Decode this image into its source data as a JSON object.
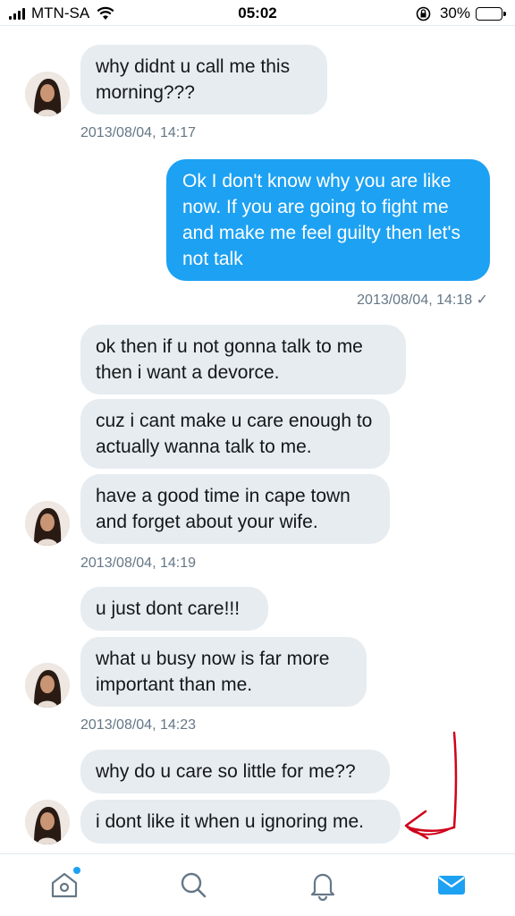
{
  "status_bar": {
    "carrier": "MTN-SA",
    "time": "05:02",
    "battery": "30%",
    "battery_level": 0.3,
    "icons": [
      "signal-icon",
      "wifi-icon",
      "orientation-lock-icon",
      "battery-icon"
    ]
  },
  "messages": [
    {
      "from": "them",
      "text": "why didnt u call me this morning???"
    },
    {
      "timestamp": "2013/08/04, 14:17"
    },
    {
      "from": "me",
      "text": "Ok I don't know why you are like now. If you are going to fight me and make me feel guilty then let's not talk"
    },
    {
      "timestamp": "2013/08/04, 14:18 ✓"
    },
    {
      "from": "them",
      "text": "ok then if u not gonna talk to me then i want a devorce."
    },
    {
      "from": "them",
      "text": "cuz i cant make u care enough to actually wanna talk to me."
    },
    {
      "from": "them",
      "text": "have a good time in cape town and forget about your wife."
    },
    {
      "timestamp": "2013/08/04, 14:19"
    },
    {
      "from": "them",
      "text": "u just dont care!!!"
    },
    {
      "from": "them",
      "text": "what u busy now is far more important than me."
    },
    {
      "timestamp": "2013/08/04, 14:23"
    },
    {
      "from": "them",
      "text": "why do u care so little for me??"
    },
    {
      "from": "them",
      "text": "i dont like it when u ignoring me."
    }
  ],
  "tab_bar": {
    "tabs": [
      "home-icon",
      "search-icon",
      "notifications-icon",
      "messages-icon"
    ],
    "active": "messages-icon",
    "accent_color": "#1da1f2"
  },
  "colors": {
    "incoming_bubble": "#e6ecf0",
    "outgoing_bubble": "#1da1f2",
    "timestamp_text": "#657786",
    "annotation_arrow": "#d0021b"
  }
}
